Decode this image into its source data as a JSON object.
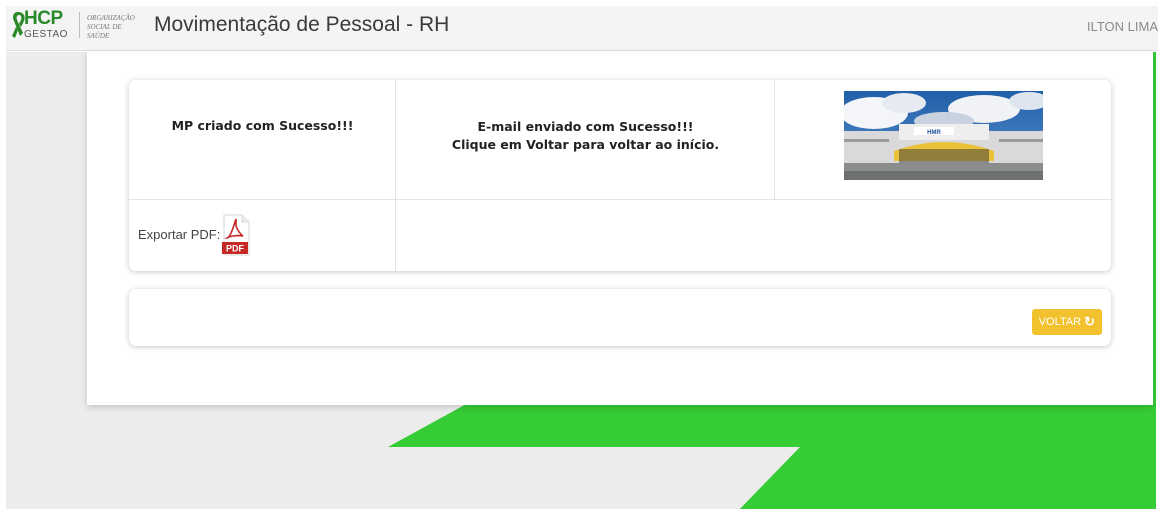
{
  "header": {
    "logo_name": "HCP",
    "logo_sub": "GESTAO",
    "org_line1": "ORGANIZAÇÃO",
    "org_line2": "SOCIAL DE SAÚDE",
    "title": "Movimentação de Pessoal - RH",
    "user": "ILTON LIMA"
  },
  "result": {
    "mp_message": "MP criado com Sucesso!!!",
    "email_line1": "E-mail enviado com Sucesso!!!",
    "email_line2": "Clique em Voltar para voltar ao início.",
    "building_sign": "HMR",
    "export_label": "Exportar PDF:",
    "pdf_icon_text": "PDF"
  },
  "actions": {
    "voltar_label": "VOLTAR",
    "voltar_icon": "undo-icon"
  },
  "colors": {
    "accent_green": "#35cc35",
    "button_yellow": "#f2c12e",
    "pdf_red": "#c62828"
  }
}
